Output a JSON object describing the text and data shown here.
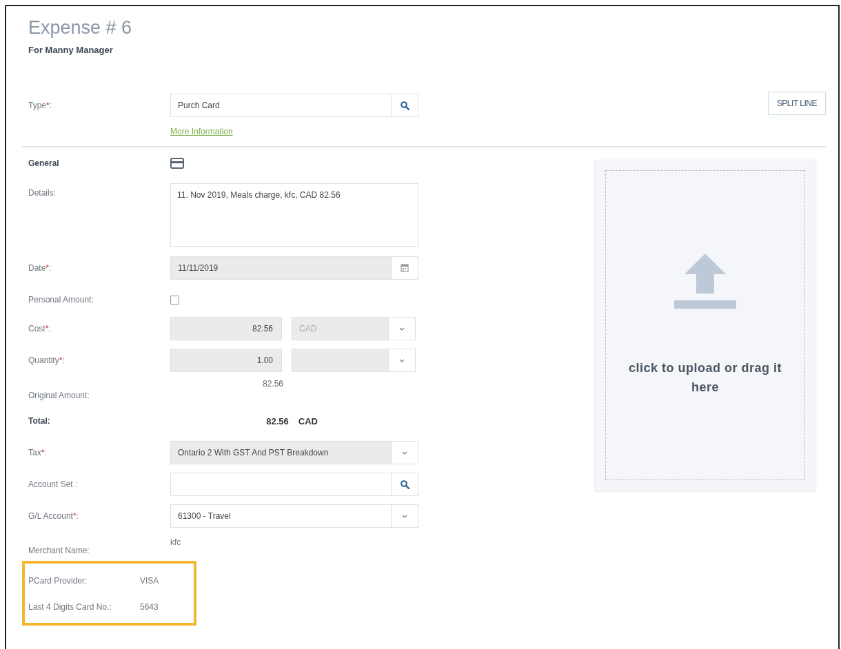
{
  "title": "Expense # 6",
  "subtitle": "For  Manny Manager",
  "type_field": {
    "label": "Type",
    "asterisk": "*",
    "colon": ":",
    "value": "Purch Card"
  },
  "more_info_link": "More Information",
  "split_button": "SPLIT LINE",
  "section": {
    "label": "General"
  },
  "fields": [
    {
      "kind": "textarea",
      "label": "Details:",
      "value": "11. Nov 2019, Meals charge, kfc, CAD 82.56"
    },
    {
      "kind": "date",
      "label": "Date",
      "asterisk": "*",
      "colon": ":",
      "value": "11/11/2019",
      "disabled": true
    },
    {
      "kind": "checkbox",
      "label": "Personal Amount:",
      "checked": false
    },
    {
      "kind": "amount",
      "label": "Cost",
      "asterisk": "*",
      "colon": ":",
      "value": "82.56",
      "unit": "CAD",
      "disabled": true
    },
    {
      "kind": "amount",
      "label": "Quantity",
      "asterisk": "*",
      "colon": ":",
      "value": "1.00",
      "disabled": true
    },
    {
      "kind": "display",
      "label": "Original Amount:",
      "value": "82.56"
    },
    {
      "kind": "total",
      "label": "Total:",
      "value": "82.56",
      "unit": "CAD"
    },
    {
      "kind": "select",
      "label": "Tax",
      "asterisk": "*",
      "colon": ":",
      "value": "Ontario 2 With GST And PST Breakdown",
      "disabled": true
    },
    {
      "kind": "lookup",
      "label": "Account Set :"
    },
    {
      "kind": "select",
      "label": "G/L Account",
      "asterisk": "*",
      "colon": ":",
      "value": "61300 - Travel",
      "disabled": false
    },
    {
      "kind": "static",
      "label": "Merchant Name:",
      "value": "kfc"
    }
  ],
  "highlighted_fields": [
    {
      "kind": "static",
      "label": "PCard Provider:",
      "value": "VISA"
    },
    {
      "kind": "static",
      "label": "Last 4 Digits Card No.:",
      "value": "5643"
    }
  ],
  "upload": {
    "text": "click to upload or drag it here"
  }
}
